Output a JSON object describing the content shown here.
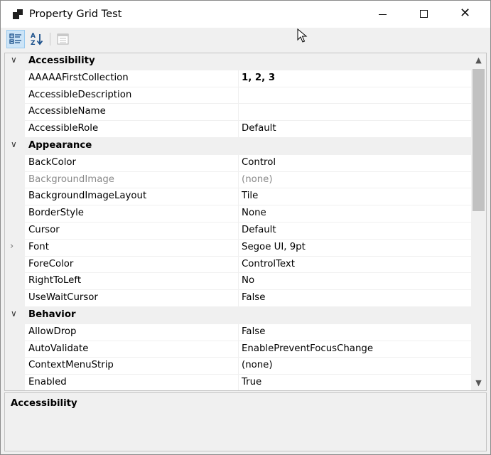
{
  "window": {
    "title": "Property Grid Test",
    "controls": {
      "minimize": "minimize",
      "maximize": "maximize",
      "close": "✕"
    }
  },
  "toolbar": {
    "buttons": [
      {
        "name": "categorized-view",
        "selected": true
      },
      {
        "name": "alphabetical-view",
        "selected": false
      },
      {
        "name": "property-pages",
        "selected": false,
        "disabled": true
      }
    ]
  },
  "grid": {
    "categories": [
      {
        "name": "Accessibility",
        "expanded": true,
        "properties": [
          {
            "name": "AAAAAFirstCollection",
            "value": "1, 2, 3",
            "bold": true
          },
          {
            "name": "AccessibleDescription",
            "value": ""
          },
          {
            "name": "AccessibleName",
            "value": ""
          },
          {
            "name": "AccessibleRole",
            "value": "Default"
          }
        ]
      },
      {
        "name": "Appearance",
        "expanded": true,
        "properties": [
          {
            "name": "BackColor",
            "value": "Control"
          },
          {
            "name": "BackgroundImage",
            "value": "(none)",
            "grey": true
          },
          {
            "name": "BackgroundImageLayout",
            "value": "Tile"
          },
          {
            "name": "BorderStyle",
            "value": "None"
          },
          {
            "name": "Cursor",
            "value": "Default"
          },
          {
            "name": "Font",
            "value": "Segoe UI, 9pt",
            "expandable": true
          },
          {
            "name": "ForeColor",
            "value": "ControlText"
          },
          {
            "name": "RightToLeft",
            "value": "No"
          },
          {
            "name": "UseWaitCursor",
            "value": "False"
          }
        ]
      },
      {
        "name": "Behavior",
        "expanded": true,
        "properties": [
          {
            "name": "AllowDrop",
            "value": "False"
          },
          {
            "name": "AutoValidate",
            "value": "EnablePreventFocusChange"
          },
          {
            "name": "ContextMenuStrip",
            "value": "(none)"
          },
          {
            "name": "Enabled",
            "value": "True"
          }
        ]
      }
    ]
  },
  "description": {
    "title": "Accessibility",
    "text": ""
  }
}
